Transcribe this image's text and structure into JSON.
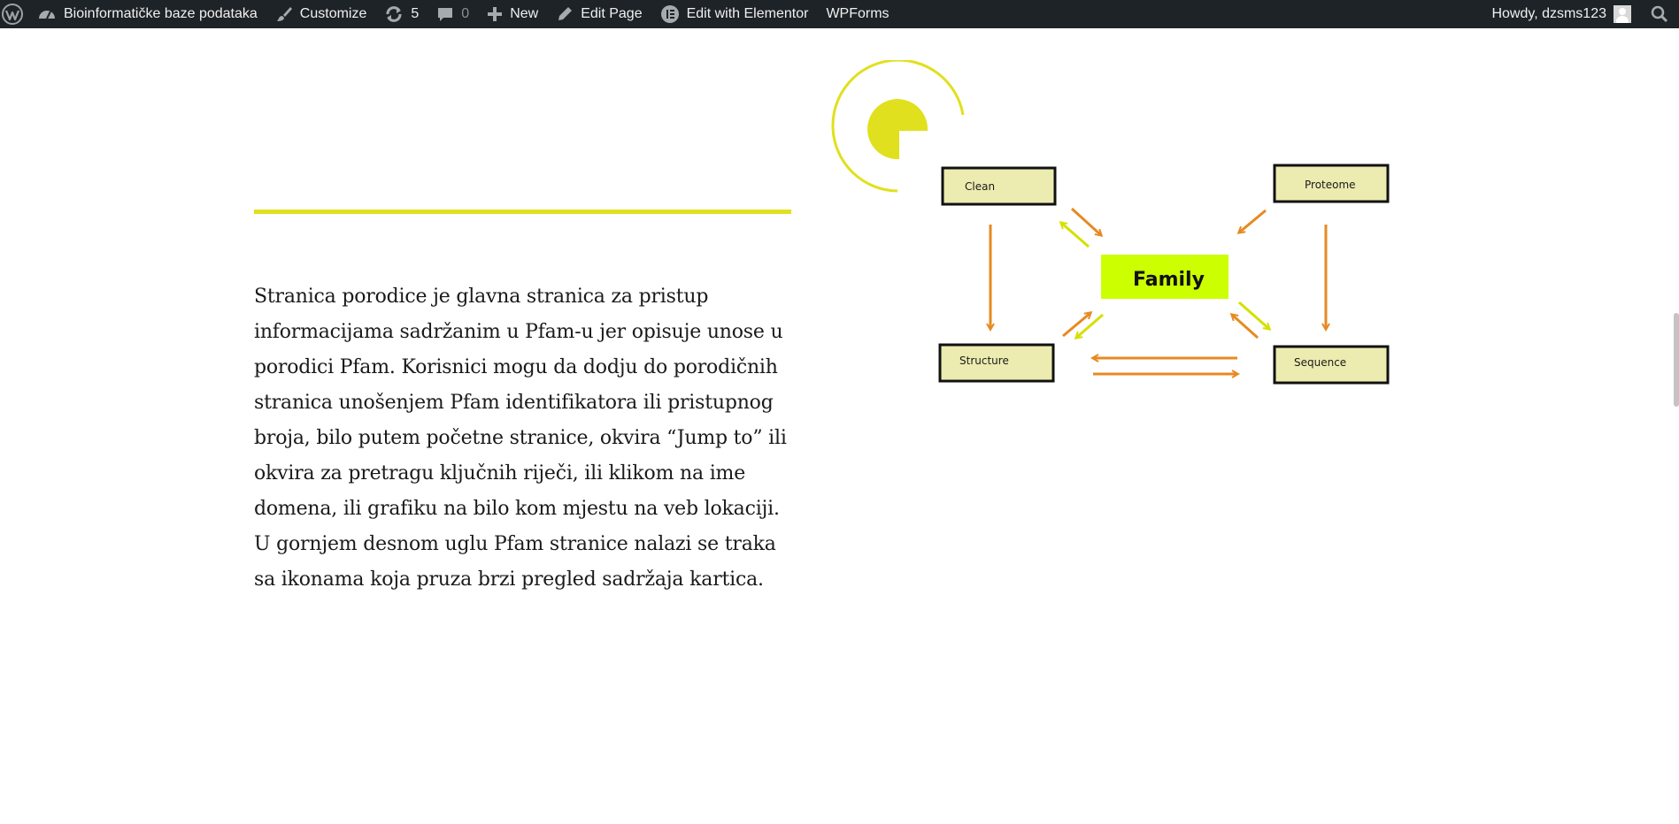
{
  "adminbar": {
    "site_name": "Bioinformatičke baze podataka",
    "customize": "Customize",
    "updates_count": "5",
    "comments_count": "0",
    "new_label": "New",
    "edit_page": "Edit Page",
    "elementor": "Edit with Elementor",
    "wpforms": "WPForms",
    "howdy": "Howdy, dzsms123"
  },
  "content": {
    "paragraph": "Stranica porodice je glavna stranica za pristup informacijama sadržanim u Pfam-u jer opisuje unose u porodici Pfam. Korisnici mogu da dodju do porodičnih stranica unošenjem Pfam identifikatora ili pristupnog broja, bilo putem početne stranice, okvira “Jump to” ili okvira za pretragu ključnih riječi, ili klikom na ime domena, ili grafiku na bilo kom mjestu na veb lokaciji. U gornjem desnom uglu Pfam stranice nalazi se traka sa ikonama koja pruza brzi pregled sadržaja kartica."
  },
  "diagram": {
    "center_label": "Family",
    "nodes": {
      "clean": "Clean",
      "proteome": "Proteome",
      "structure": "Structure",
      "sequence": "Sequence"
    }
  },
  "colors": {
    "accent": "#e0e01e",
    "family_fill": "#ccff00",
    "node_fill": "#ececb0",
    "arrow_orange": "#e68a22",
    "arrow_yellow": "#d4e000",
    "adminbar_bg": "#1d2327"
  },
  "icons": [
    "wordpress-icon",
    "dashboard-icon",
    "paintbrush-icon",
    "updates-icon",
    "comment-icon",
    "plus-icon",
    "pencil-icon",
    "elementor-icon",
    "avatar",
    "search-icon"
  ]
}
